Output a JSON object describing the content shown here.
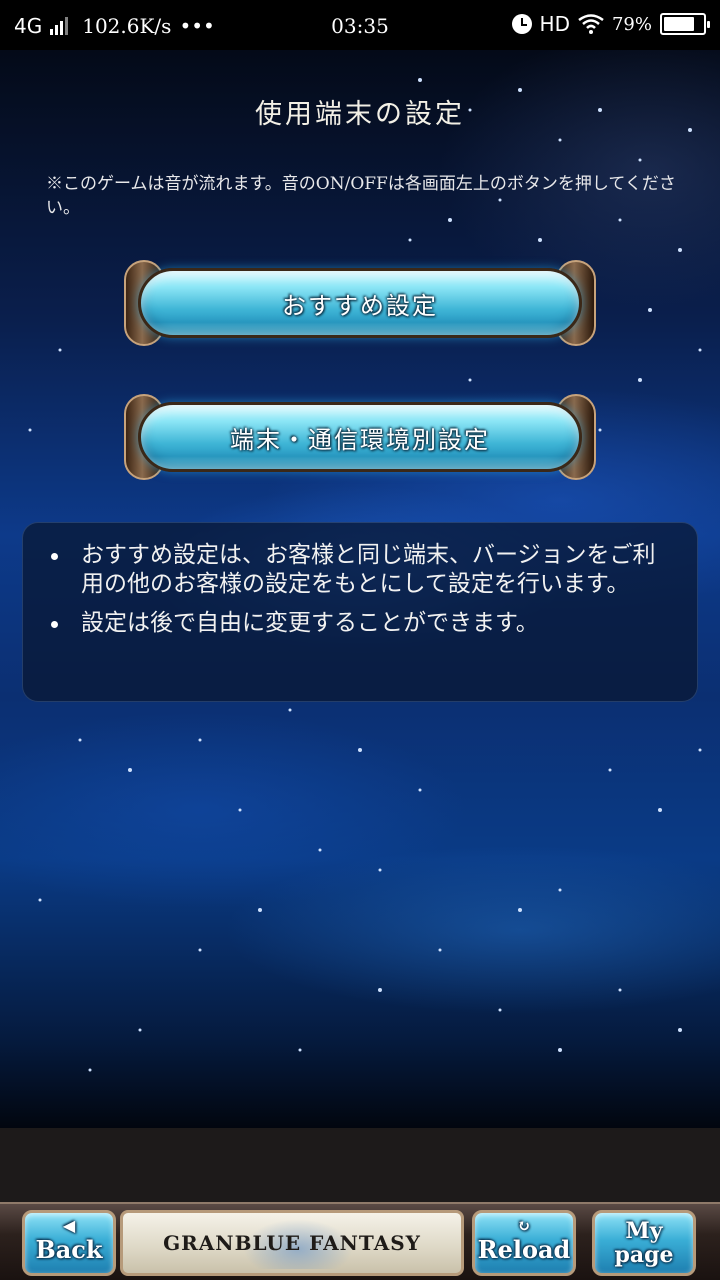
{
  "status_bar": {
    "network": "4G",
    "speed": "102.6K/s",
    "dots": "•••",
    "time": "03:35",
    "hd": "HD",
    "battery_percent": "79%",
    "battery_level": 0.79,
    "icons": [
      "signal-icon",
      "alarm-icon",
      "wifi-icon",
      "battery-icon"
    ]
  },
  "page": {
    "title": "使用端末の設定",
    "notice": "※このゲームは音が流れます。音のON/OFFは各画面左上のボタンを押してください。"
  },
  "buttons": {
    "recommended": "おすすめ設定",
    "by_device": "端末・通信環境別設定"
  },
  "info": {
    "items": [
      "おすすめ設定は、お客様と同じ端末、バージョンをご利用の他のお客様の設定をもとにして設定を行います。",
      "設定は後で自由に変更することができます。"
    ]
  },
  "bottom_nav": {
    "back_label": "Back",
    "logo_text": "GRANBLUE FANTASY",
    "reload_label": "Reload",
    "mypage_label_1": "My",
    "mypage_label_2": "page"
  },
  "colors": {
    "button_cyan": "#3fb5d6",
    "panel": "#081630",
    "background_blue": "#0d3a8a"
  }
}
